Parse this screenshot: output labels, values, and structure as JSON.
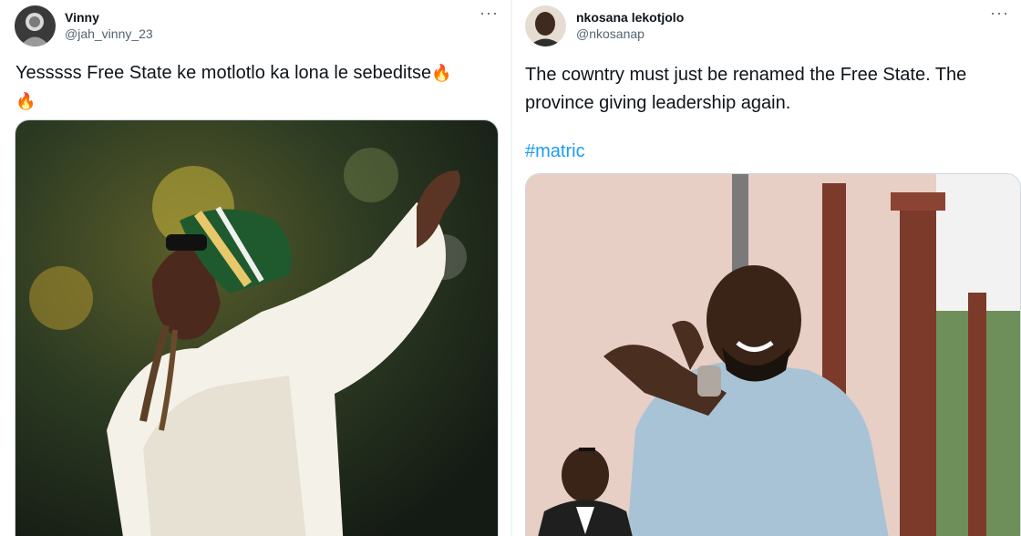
{
  "tweet1": {
    "author_name": "Vinny",
    "author_handle": "@jah_vinny_23",
    "text": "Yesssss Free State ke motlotlo ka lona le sebeditse",
    "emoji_1": "🔥",
    "emoji_2": "🔥",
    "more_label": "···"
  },
  "tweet2": {
    "author_name": "nkosana lekotjolo",
    "author_handle": "@nkosanap",
    "text_line_1": "The cowntry must just be renamed the Free State. The",
    "text_line_2": "province giving leadership again.",
    "hashtag": "#matric",
    "more_label": "···"
  },
  "colors": {
    "text": "#0f1419",
    "secondary": "#536471",
    "link": "#1d9bf0",
    "border": "#cfd9de"
  },
  "icons": [
    "more-options-icon",
    "fire-emoji-icon"
  ]
}
